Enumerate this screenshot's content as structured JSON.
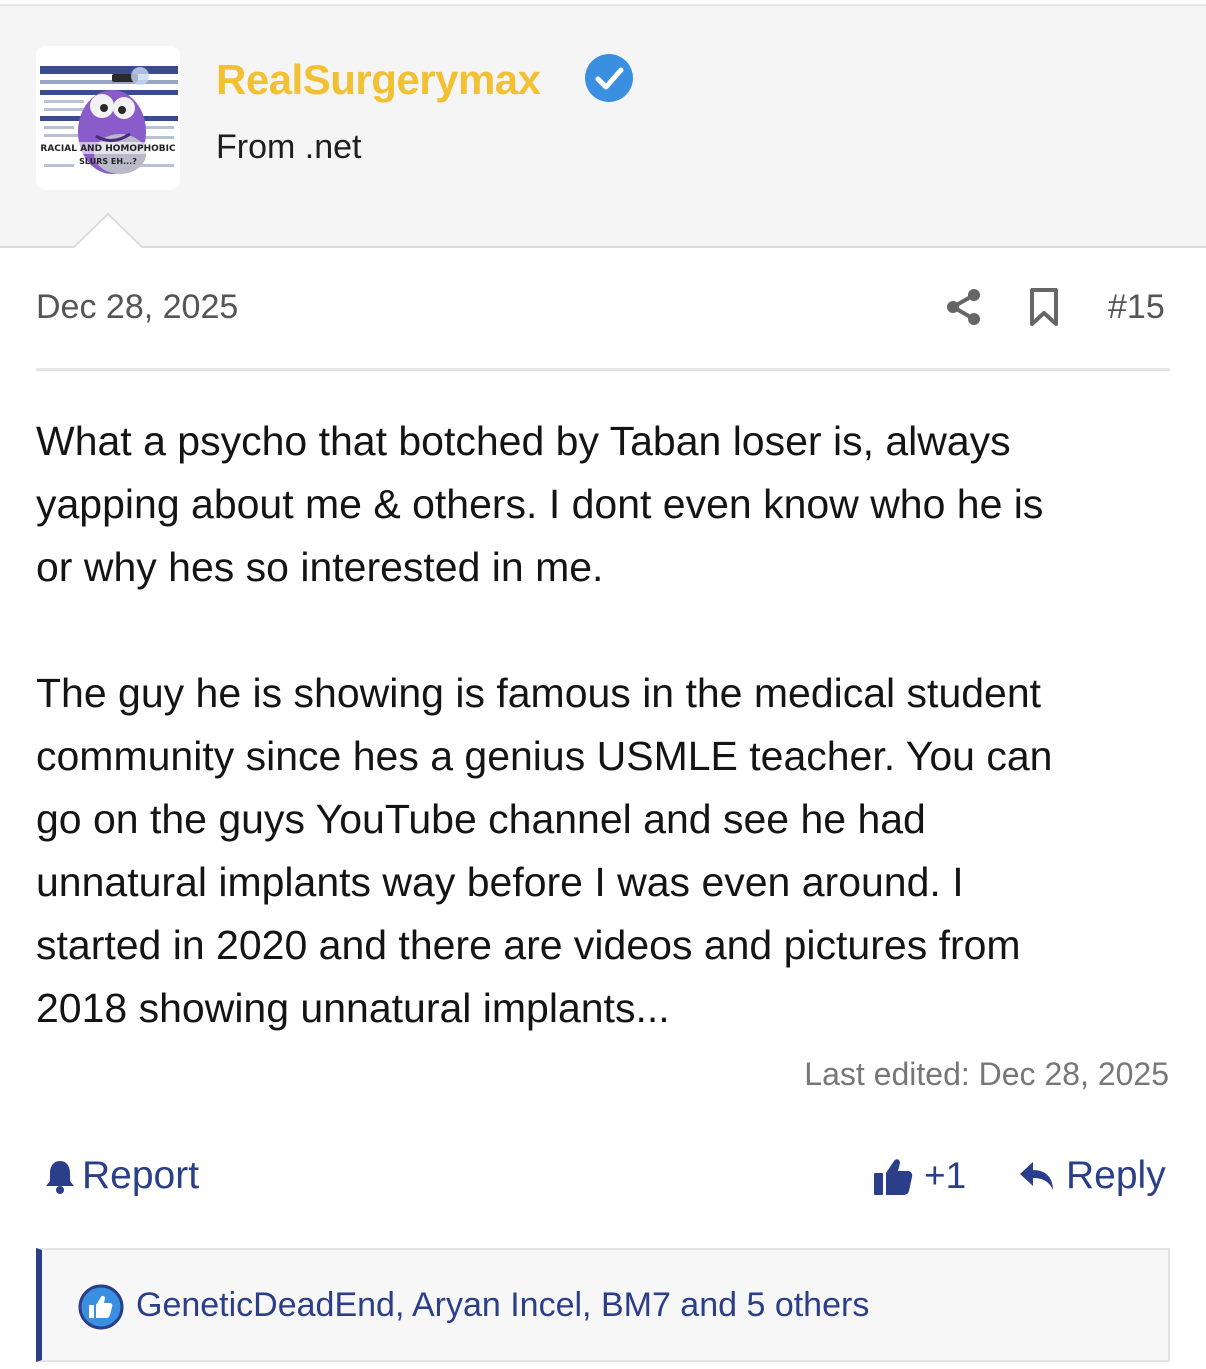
{
  "user": {
    "name": "RealSurgerymax",
    "title": "From .net",
    "verified": true,
    "avatar_caption": "RACIAL AND HOMOPHOBIC SLURS EH...?"
  },
  "attribution": {
    "date": "Dec 28, 2025",
    "post_number": "#15"
  },
  "message": {
    "paragraph1_lines": [
      "What a psycho that botched by Taban loser is, always",
      "yapping about me & others. I dont even know who he is",
      "or why hes so interested in me."
    ],
    "paragraph2_lines": [
      "The guy he is showing is famous in the medical student",
      "community since hes a genius USMLE teacher. You can",
      "go on the guys YouTube channel and see he had",
      "unnatural implants way before I was even around. I",
      "started in 2020 and there are videos and pictures from",
      "2018 showing unnatural implants..."
    ],
    "last_edited": "Last edited: Dec 28, 2025"
  },
  "actions": {
    "report_label": "Report",
    "like_label": "+1",
    "reply_label": "Reply"
  },
  "reactions": {
    "text": "GeneticDeadEnd, Aryan Incel, BM7 and 5 others"
  },
  "colors": {
    "username": "#f1c033",
    "link": "#2a3e8a",
    "verified": "#3b8fe0"
  }
}
